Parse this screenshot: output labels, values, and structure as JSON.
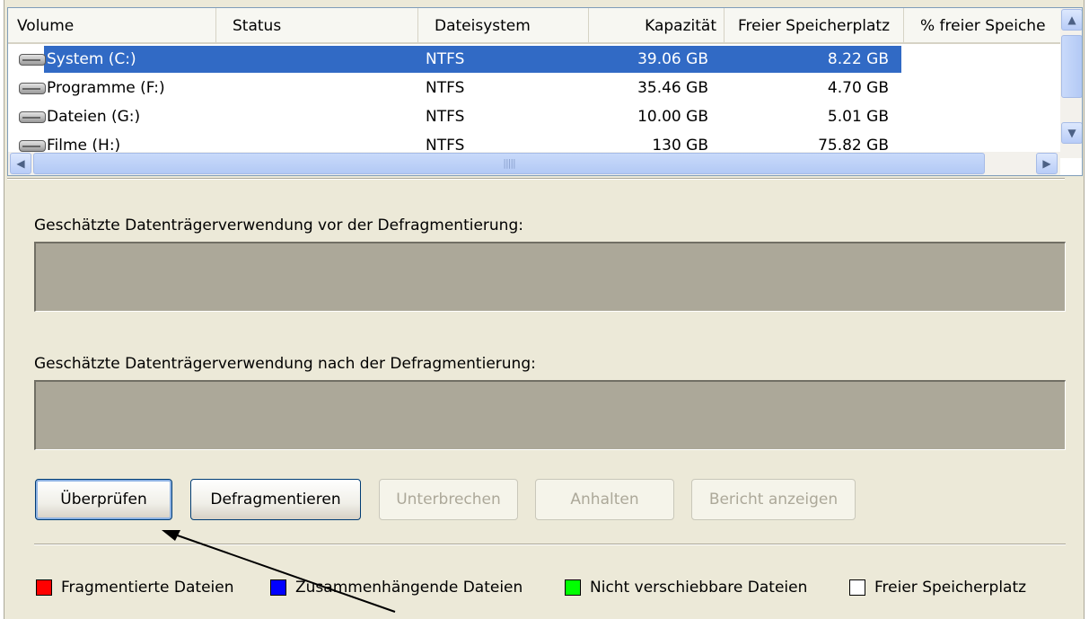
{
  "list": {
    "columns": [
      "Volume",
      "Status",
      "Dateisystem",
      "Kapazität",
      "Freier Speicherplatz",
      "% freier Speiche"
    ],
    "rows": [
      {
        "volume": "System (C:)",
        "status": "",
        "fs": "NTFS",
        "capacity": "39.06 GB",
        "free": "8.22 GB",
        "pct": ""
      },
      {
        "volume": "Programme (F:)",
        "status": "",
        "fs": "NTFS",
        "capacity": "35.46 GB",
        "free": "4.70 GB",
        "pct": ""
      },
      {
        "volume": "Dateien (G:)",
        "status": "",
        "fs": "NTFS",
        "capacity": "10.00 GB",
        "free": "5.01 GB",
        "pct": ""
      },
      {
        "volume": "Filme (H:)",
        "status": "",
        "fs": "NTFS",
        "capacity": "130 GB",
        "free": "75.82 GB",
        "pct": ""
      }
    ],
    "selected_index": 0
  },
  "analysis": {
    "before_label": "Geschätzte Datenträgerverwendung vor der Defragmentierung:",
    "after_label": "Geschätzte Datenträgerverwendung nach der Defragmentierung:"
  },
  "buttons": {
    "check": "Überprüfen",
    "defrag": "Defragmentieren",
    "interrupt": "Unterbrechen",
    "stop": "Anhalten",
    "report": "Bericht anzeigen"
  },
  "legend": [
    {
      "label": "Fragmentierte Dateien",
      "color": "#ff0000"
    },
    {
      "label": "Zusammenhängende Dateien",
      "color": "#0000ff"
    },
    {
      "label": "Nicht verschiebbare Dateien",
      "color": "#00ff00"
    },
    {
      "label": "Freier Speicherplatz",
      "color": "#ffffff"
    }
  ],
  "colors": {
    "selection": "#316ac5",
    "window_bg": "#ece9d8",
    "bar_bg": "#aca899"
  }
}
